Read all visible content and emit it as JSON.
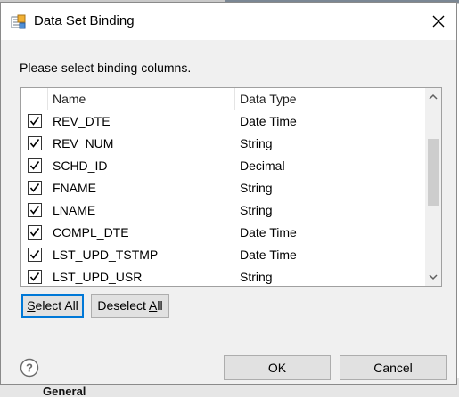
{
  "window": {
    "title": "Data Set Binding",
    "title_icon": "data-set-binding-icon",
    "close_icon": "close-icon"
  },
  "instruction": "Please select binding columns.",
  "table": {
    "headers": [
      "Name",
      "Data Type"
    ],
    "rows": [
      {
        "checked": true,
        "name": "REV_DTE",
        "type": "Date Time"
      },
      {
        "checked": true,
        "name": "REV_NUM",
        "type": "String"
      },
      {
        "checked": true,
        "name": "SCHD_ID",
        "type": "Decimal"
      },
      {
        "checked": true,
        "name": "FNAME",
        "type": "String"
      },
      {
        "checked": true,
        "name": "LNAME",
        "type": "String"
      },
      {
        "checked": true,
        "name": "COMPL_DTE",
        "type": "Date Time"
      },
      {
        "checked": true,
        "name": "LST_UPD_TSTMP",
        "type": "Date Time"
      },
      {
        "checked": true,
        "name": "LST_UPD_USR",
        "type": "String"
      }
    ]
  },
  "buttons": {
    "select_all": {
      "mnemonic": "S",
      "rest": "elect All"
    },
    "deselect_all": {
      "prefix": "Deselect ",
      "mnemonic": "A",
      "rest": "ll"
    },
    "ok": "OK",
    "cancel": "Cancel"
  },
  "help_icon": "help-icon",
  "background": {
    "partial_label": "General"
  },
  "colors": {
    "accent": "#0078d7",
    "dialog_bg": "#f0f0f0",
    "scroll_thumb": "#cdcdcd"
  }
}
